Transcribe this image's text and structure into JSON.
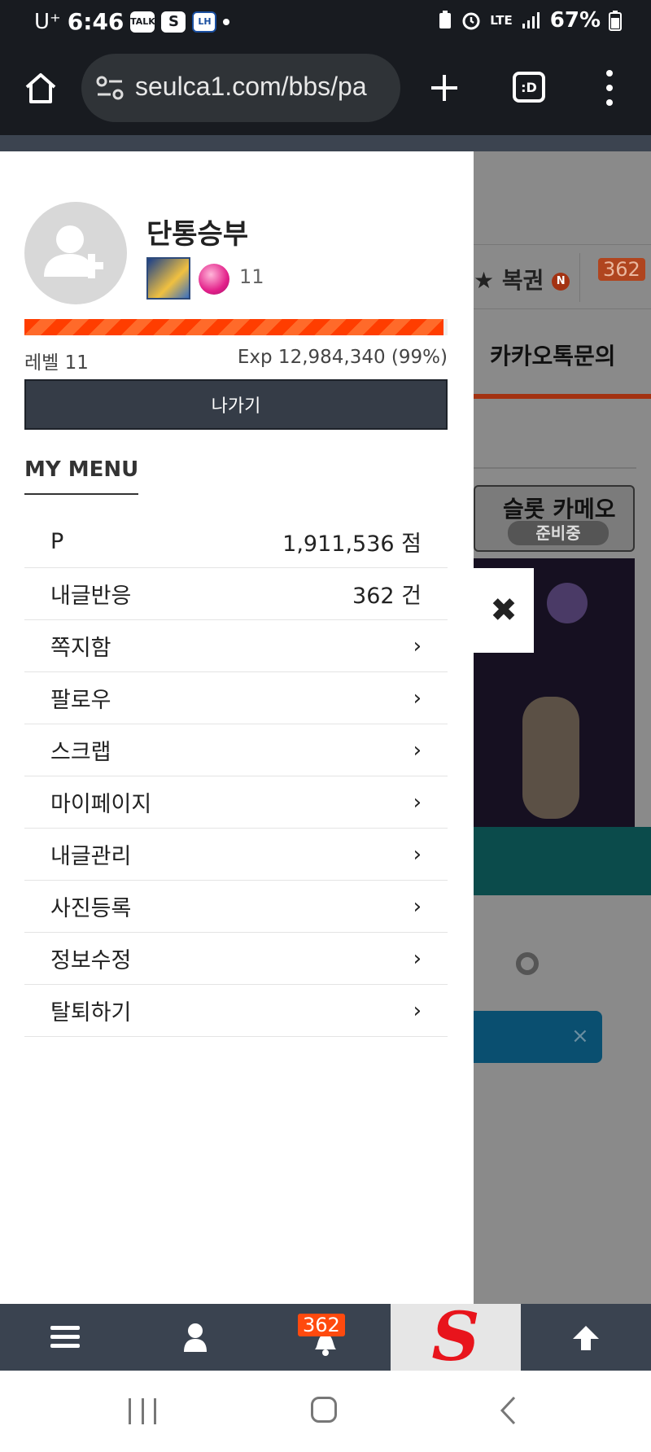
{
  "status_bar": {
    "carrier": "U⁺",
    "time": "6:46",
    "notif_icons": [
      "talk-icon",
      "s-app-icon",
      "lh-app-icon"
    ],
    "notif_labels": [
      "TALK",
      "S",
      "LH"
    ],
    "network": "LTE",
    "battery": "67%"
  },
  "browser": {
    "url": "seulca1.com/bbs/pa",
    "tabs_label": ":D"
  },
  "drawer": {
    "nickname": "단통승부",
    "level_badge": "11",
    "level_label": "레벨 11",
    "exp_label": "Exp 12,984,340 (99%)",
    "exp_progress": 0.99,
    "logout_label": "나가기",
    "menu_title": "MY MENU",
    "stats": [
      {
        "label": "P",
        "value": "1,911,536 점"
      },
      {
        "label": "내글반응",
        "value": "362 건"
      }
    ],
    "menu_items": [
      {
        "label": "쪽지함",
        "chevron": "›"
      },
      {
        "label": "팔로우",
        "chevron": "›"
      },
      {
        "label": "스크랩",
        "chevron": "›"
      },
      {
        "label": "마이페이지",
        "chevron": "›"
      },
      {
        "label": "내글관리",
        "chevron": "›"
      },
      {
        "label": "사진등록",
        "chevron": "›"
      },
      {
        "label": "정보수정",
        "chevron": "›"
      },
      {
        "label": "탈퇴하기",
        "chevron": "›"
      }
    ]
  },
  "background_page": {
    "lotto_label": "복권",
    "new_badge": "N",
    "bell_count": "362",
    "kakao_label": "카카오톡문의",
    "banner_title": "슬롯 카메오",
    "banner_sub": "준비중",
    "close_x": "×"
  },
  "close_button": "✖",
  "app_bar": {
    "bell_count": "362",
    "logo_letter": "S"
  },
  "colors": {
    "accent": "#ff3d00",
    "dark": "#353c47",
    "status_bg": "#181b20"
  }
}
